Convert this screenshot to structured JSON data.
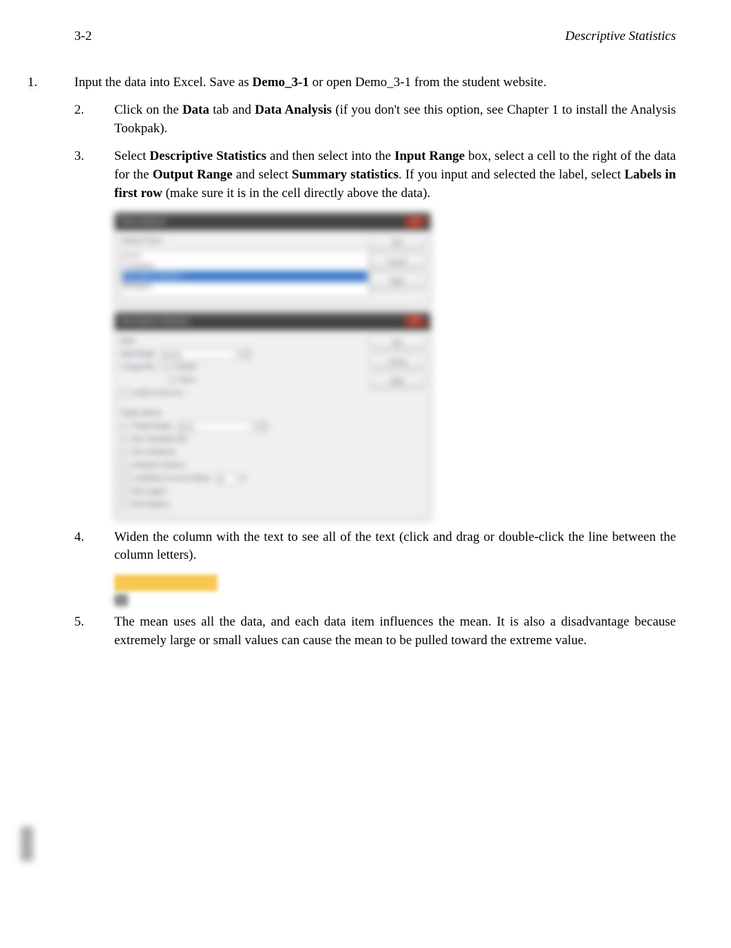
{
  "header": {
    "page_number": "3-2",
    "title": "Descriptive Statistics"
  },
  "step1": {
    "num": "1.",
    "t1": "Input the data into Excel. Save as ",
    "bold1": "Demo_3-1",
    "t2": " or open Demo_3-1 from the student website."
  },
  "step2": {
    "num": "2.",
    "t1": "Click on the ",
    "bold1": "Data",
    "t2": " tab and ",
    "bold2": "Data Analysis",
    "t3": " (if you don't see this option, see Chapter 1 to install the Analysis Tookpak)."
  },
  "step3": {
    "num": "3.",
    "t1": "Select ",
    "bold1": "Descriptive Statistics",
    "t2": " and then select into the ",
    "bold2": "Input Range",
    "t3": " box, select a cell to the right of the data for the ",
    "bold3": "Output Range",
    "t4": " and select ",
    "bold4": "Summary statistics",
    "t5": ". If you input and selected the label, select ",
    "bold5": "Labels in first row",
    "t6": " (make sure it is in the cell directly above the data)."
  },
  "step4": {
    "num": "4.",
    "text": "Widen the column with the text to see all of the text (click and drag or double-click the line between the column letters)."
  },
  "step5": {
    "num": "5.",
    "text": "The mean uses all the data, and each data item influences the mean. It is also a disadvantage because extremely large or small values can cause the mean to be pulled toward the extreme value."
  },
  "dialog1": {
    "title": "Data Analysis",
    "ok": "OK",
    "cancel": "Cancel",
    "help": "Help",
    "label_tools": "Analysis Tools",
    "selected": "Descriptive Statistics"
  },
  "dialog2": {
    "title": "Descriptive Statistics",
    "ok": "OK",
    "cancel": "Cancel",
    "help": "Help",
    "section_input": "Input",
    "lbl_input_range": "Input Range:",
    "val_input_range": "$A:$A",
    "lbl_grouped": "Grouped By:",
    "grp_cols": "Columns",
    "grp_rows": "Rows",
    "chk_labels": "Labels in first row",
    "section_output": "Output options",
    "lbl_output_range": "Output Range:",
    "val_output_range": "$C$1",
    "opt_new_ws": "New Worksheet Ply:",
    "opt_new_wb": "New Workbook",
    "chk_summary": "Summary statistics",
    "chk_conf": "Confidence Level for Mean:",
    "conf_val": "95",
    "pct": "%",
    "chk_kth_l": "Kth Largest:",
    "chk_kth_s": "Kth Smallest:"
  }
}
